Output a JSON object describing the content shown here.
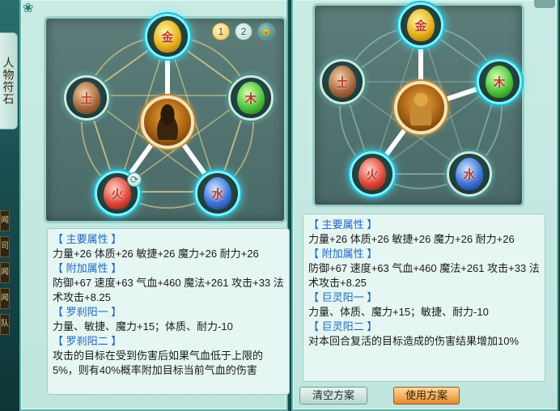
{
  "side_tab": {
    "label": "人物符石"
  },
  "side_strip": [
    "闻",
    "司",
    "闻",
    "闻",
    "队"
  ],
  "left_panel": {
    "page_dots": [
      "1",
      "2",
      "🔒"
    ],
    "elements": {
      "gold": "金",
      "wood": "木",
      "water": "水",
      "fire": "火",
      "earth": "土"
    },
    "refresh_icon": "⟳",
    "sections": [
      {
        "title": "【 主要属性 】",
        "body": "力量+26 体质+26 敏捷+26 魔力+26 耐力+26"
      },
      {
        "title": "【 附加属性 】",
        "body": "防御+67 速度+63 气血+460 魔法+261 攻击+33 法术攻击+8.25"
      },
      {
        "title": "【 罗刹阳一 】",
        "body": "力量、敏捷、魔力+15；体质、耐力-10"
      },
      {
        "title": "【 罗刹阳二 】",
        "body": "攻击的目标在受到伤害后如果气血低于上限的5%，则有40%概率附加目标当前气血的伤害"
      }
    ]
  },
  "right_panel": {
    "elements": {
      "gold": "金",
      "wood": "木",
      "water": "水",
      "fire": "火",
      "earth": "土"
    },
    "sections": [
      {
        "title": "【 主要属性 】",
        "body": "力量+26 体质+26 敏捷+26 魔力+26 耐力+26"
      },
      {
        "title": "【 附加属性 】",
        "body": "防御+67 速度+63 气血+460 魔法+261 攻击+33 法术攻击+8.25"
      },
      {
        "title": "【 巨灵阳一 】",
        "body": "力量、体质、魔力+15；敏捷、耐力-10"
      },
      {
        "title": "【 巨灵阳二 】",
        "body": "对本回合复活的目标造成的伤害结果增加10%"
      }
    ],
    "buttons": {
      "clear": "清空方案",
      "use": "使用方案"
    }
  }
}
